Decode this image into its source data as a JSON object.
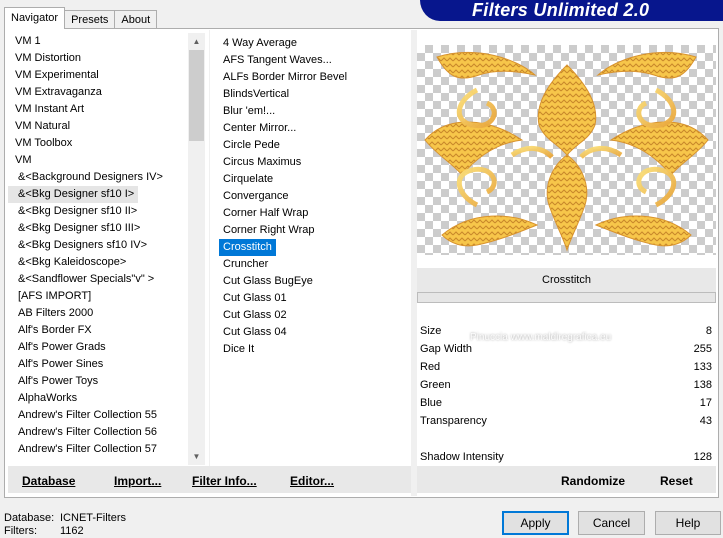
{
  "tabs": [
    "Navigator",
    "Presets",
    "About"
  ],
  "banner": {
    "title": "Filters Unlimited 2.0",
    "color": "#07168d"
  },
  "left_list": {
    "items": [
      "VM 1",
      "VM Distortion",
      "VM Experimental",
      "VM Extravaganza",
      "VM Instant Art",
      "VM Natural",
      "VM Toolbox",
      "VM",
      "&<Background Designers IV>",
      "&<Bkg Designer sf10 I>",
      "&<Bkg Designer sf10 II>",
      "&<Bkg Designer sf10 III>",
      "&<Bkg Designers sf10 IV>",
      "&<Bkg Kaleidoscope>",
      "&<Sandflower Specials\"v\" >",
      "[AFS IMPORT]",
      "AB Filters 2000",
      "Alf's Border FX",
      "Alf's Power Grads",
      "Alf's Power Sines",
      "Alf's Power Toys",
      "AlphaWorks",
      "Andrew's Filter Collection 55",
      "Andrew's Filter Collection 56",
      "Andrew's Filter Collection 57"
    ],
    "selected_index": 9
  },
  "mid_list": {
    "items": [
      "4 Way Average",
      "AFS Tangent Waves...",
      "ALFs Border Mirror Bevel",
      "BlindsVertical",
      "Blur 'em!...",
      "Center Mirror...",
      "Circle Pede",
      "Circus Maximus",
      "Cirquelate",
      "Convergance",
      "Corner Half Wrap",
      "Corner Right Wrap",
      "Crosstitch",
      "Cruncher",
      "Cut Glass  BugEye",
      "Cut Glass 01",
      "Cut Glass 02",
      "Cut Glass 04",
      "Dice It"
    ],
    "selected_index": 12,
    "selected_color": "#0078d7"
  },
  "preview": {
    "filter_name": "Crosstitch",
    "watermark": "Pinuccia  www.maldiregrafica.eu"
  },
  "params": [
    {
      "name": "Size",
      "value": "8"
    },
    {
      "name": "Gap Width",
      "value": "255"
    },
    {
      "name": "Red",
      "value": "133"
    },
    {
      "name": "Green",
      "value": "138"
    },
    {
      "name": "Blue",
      "value": "17"
    },
    {
      "name": "Transparency",
      "value": "43"
    }
  ],
  "extra_param": {
    "name": "Shadow Intensity",
    "value": "128"
  },
  "bottom_links": {
    "database": "Database",
    "import": "Import...",
    "filter_info": "Filter Info...",
    "editor": "Editor...",
    "randomize": "Randomize",
    "reset": "Reset"
  },
  "footer": {
    "database_label": "Database:",
    "database_value": "ICNET-Filters",
    "filters_label": "Filters:",
    "filters_value": "1162"
  },
  "buttons": {
    "apply": "Apply",
    "cancel": "Cancel",
    "help": "Help"
  }
}
